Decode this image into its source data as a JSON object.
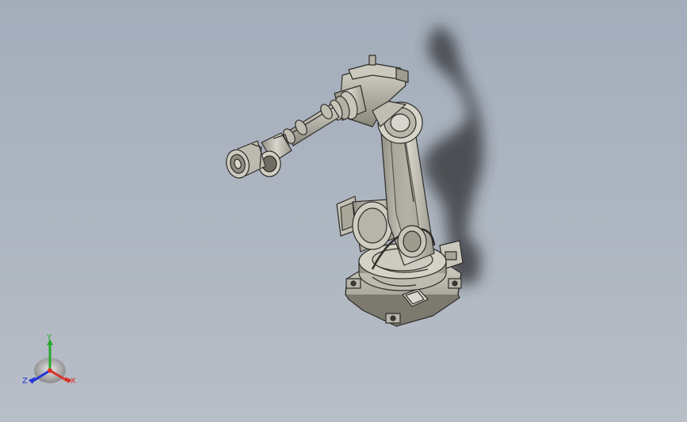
{
  "viewport": {
    "background_top": "#a3adbb",
    "background_bottom": "#b8bec7",
    "model": "six-axis-industrial-robot"
  },
  "triad": {
    "x_label": "X",
    "y_label": "Y",
    "z_label": "Z",
    "x_color": "#d8322a",
    "y_color": "#27a82d",
    "z_color": "#2236d6"
  }
}
